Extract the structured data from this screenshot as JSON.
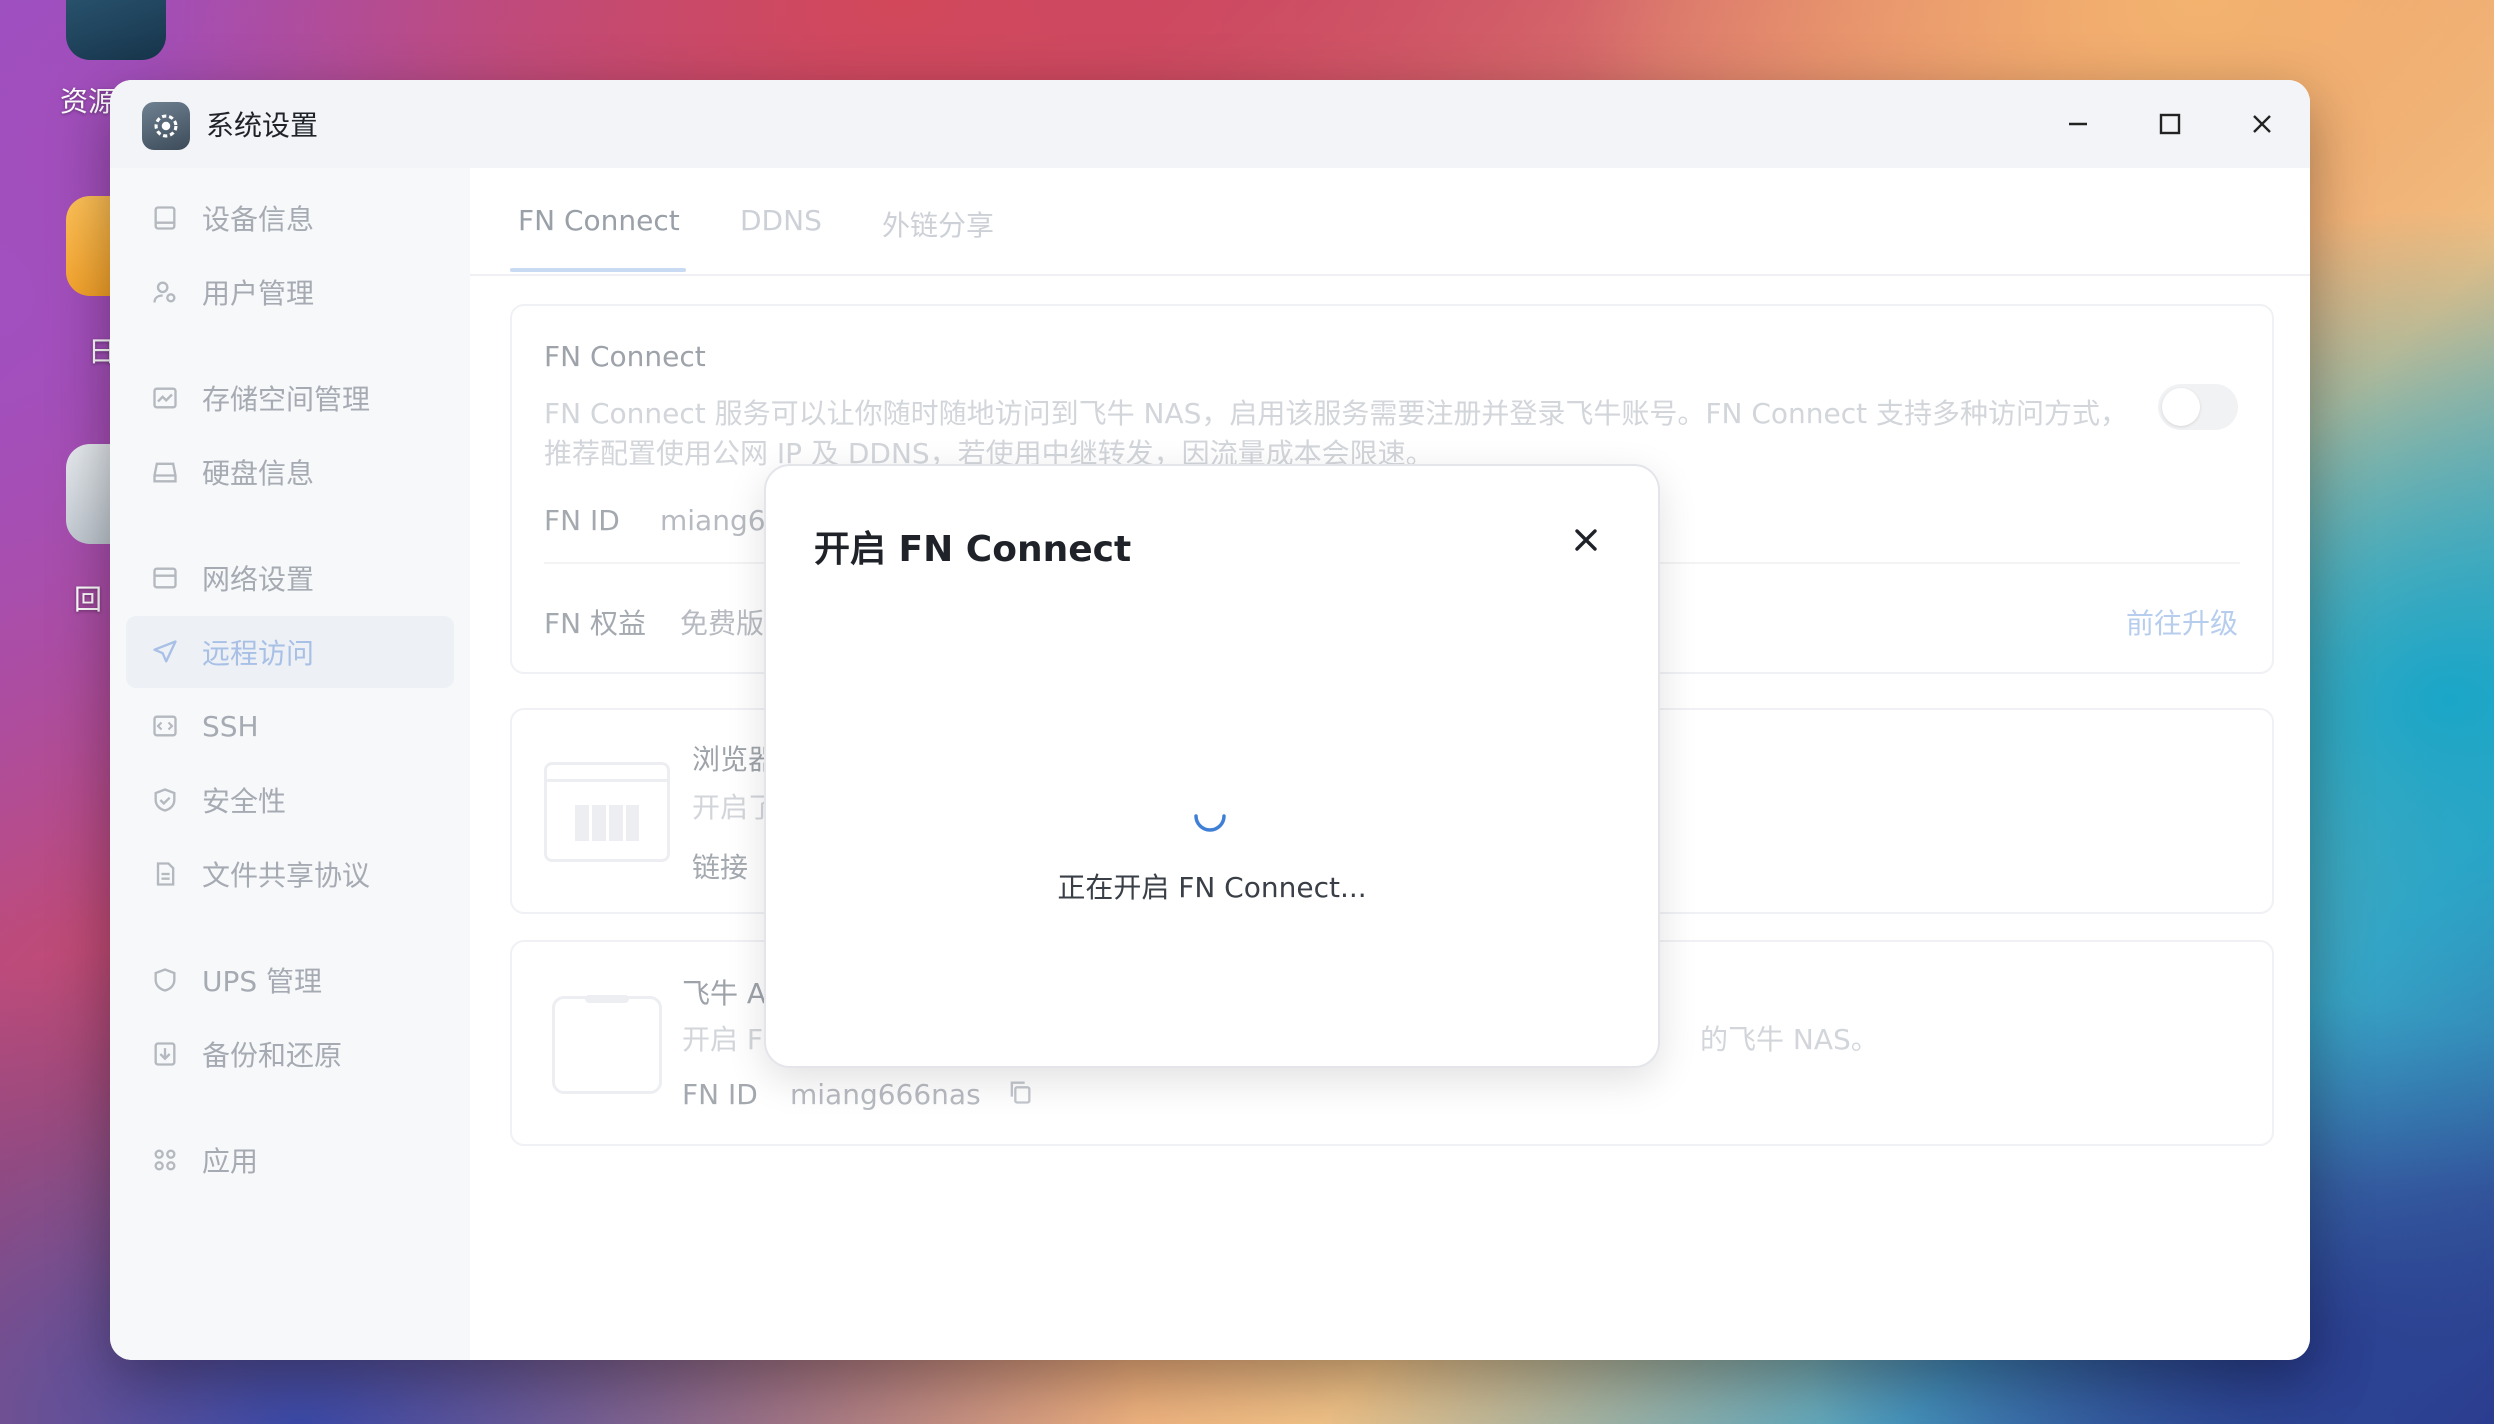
{
  "desktop": {
    "icons": [
      {
        "label": "资源"
      },
      {
        "label": "日"
      },
      {
        "label": "回"
      }
    ]
  },
  "window": {
    "title": "系统设置"
  },
  "sidebar": {
    "items": [
      {
        "label": "设备信息",
        "icon": "device-icon"
      },
      {
        "label": "用户管理",
        "icon": "user-icon"
      },
      {
        "label": "存储空间管理",
        "icon": "storage-icon"
      },
      {
        "label": "硬盘信息",
        "icon": "disk-icon"
      },
      {
        "label": "网络设置",
        "icon": "network-icon"
      },
      {
        "label": "远程访问",
        "icon": "send-icon",
        "active": true
      },
      {
        "label": "SSH",
        "icon": "code-icon"
      },
      {
        "label": "安全性",
        "icon": "shield-check-icon"
      },
      {
        "label": "文件共享协议",
        "icon": "document-icon"
      },
      {
        "label": "UPS 管理",
        "icon": "shield-icon"
      },
      {
        "label": "备份和还原",
        "icon": "backup-icon"
      },
      {
        "label": "应用",
        "icon": "apps-icon"
      }
    ]
  },
  "tabs": [
    {
      "label": "FN Connect",
      "active": true
    },
    {
      "label": "DDNS"
    },
    {
      "label": "外链分享"
    }
  ],
  "fn_connect_card": {
    "title": "FN Connect",
    "description_line1": "FN Connect 服务可以让你随时随地访问到飞牛 NAS，启用该服务需要注册并登录飞牛账号。FN Connect 支持多种访问方式，",
    "description_line2": "推荐配置使用公网 IP 及 DDNS，若使用中继转发，因流量成本会限速。",
    "fn_id_label": "FN ID",
    "fn_id_value": "miang66",
    "rights_label": "FN 权益",
    "rights_value": "免费版",
    "upgrade_link": "前往升级",
    "toggle_on": false
  },
  "browser_card": {
    "title": "浏览器",
    "text": "开启了",
    "link_label": "链接"
  },
  "app_card": {
    "title": "飞牛 A",
    "text_start": "开启 F",
    "text_end": "的飞牛 NAS。",
    "fn_id_label": "FN ID",
    "fn_id_value": "miang666nas"
  },
  "dialog": {
    "title": "开启 FN Connect",
    "status": "正在开启 FN Connect..."
  },
  "colors": {
    "accent": "#3f7fd6",
    "sidebar_active_bg": "#edf0f5"
  }
}
